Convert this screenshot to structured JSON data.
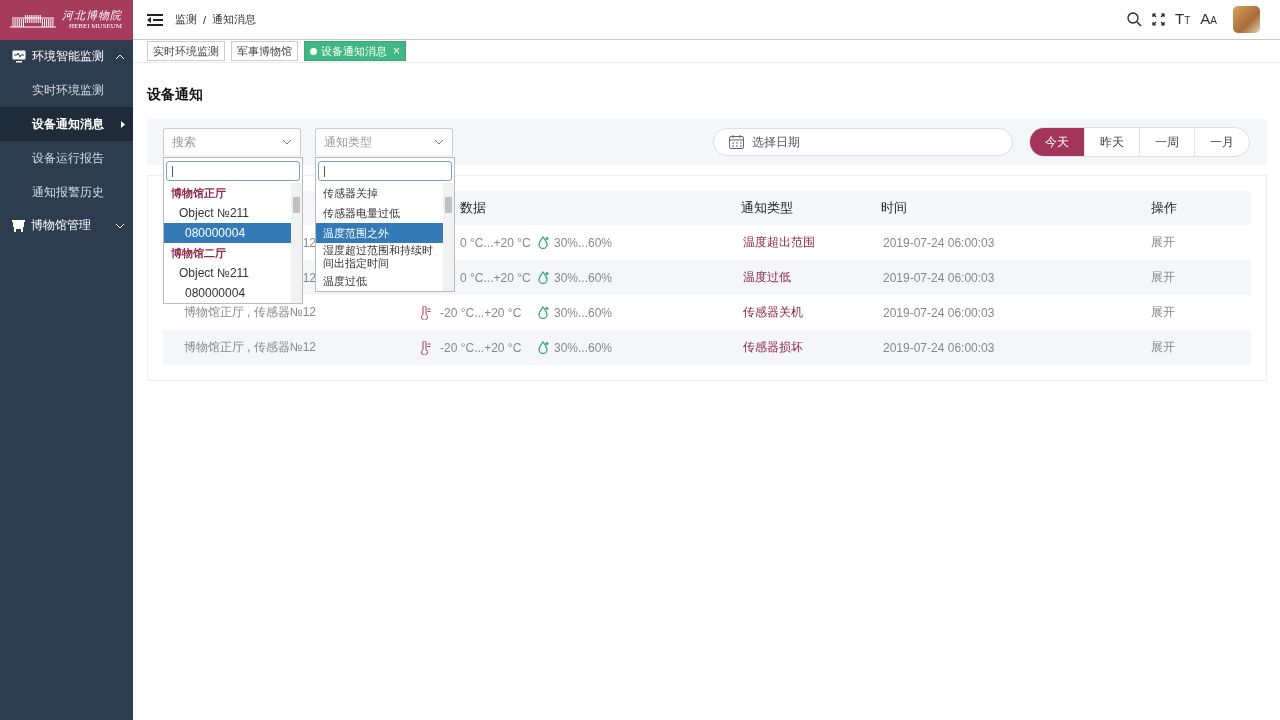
{
  "sidebar": {
    "logo": {
      "title": "河北博物院",
      "subtitle": "HEBEI MUSEUM"
    },
    "sections": [
      {
        "label": "环境智能监测",
        "expanded": true,
        "children": [
          {
            "label": "实时环境监测",
            "selected": false
          },
          {
            "label": "设备通知消息",
            "selected": true
          },
          {
            "label": "设备运行报告",
            "selected": false
          },
          {
            "label": "通知报警历史",
            "selected": false
          }
        ]
      },
      {
        "label": "博物馆管理",
        "expanded": false
      }
    ]
  },
  "header": {
    "breadcrumb": {
      "items": [
        "监测",
        "通知消息"
      ],
      "separator": "/"
    },
    "tools": [
      {
        "kind": "search"
      },
      {
        "kind": "fullscreen"
      },
      {
        "kind": "letters",
        "big": "T",
        "small": "T"
      },
      {
        "kind": "letters",
        "big": "A",
        "small": "A"
      },
      {
        "kind": "avatar"
      }
    ]
  },
  "tabs": [
    {
      "label": "实时环境监测",
      "selected": false
    },
    {
      "label": "军事博物馆",
      "selected": false
    },
    {
      "label": "设备通知消息",
      "selected": true,
      "close": "×"
    }
  ],
  "page_title": "设备通知",
  "filters": {
    "location_select": {
      "placeholder": "搜索",
      "open": true,
      "items": [
        {
          "kind": "group",
          "label": "博物馆正厅",
          "selected": false
        },
        {
          "kind": "object",
          "label": "Object №211",
          "selected": false
        },
        {
          "kind": "device",
          "label": "080000004",
          "selected": true
        },
        {
          "kind": "group",
          "label": "博物馆二厅",
          "selected": false
        },
        {
          "kind": "object",
          "label": "Object №211",
          "selected": false
        },
        {
          "kind": "device",
          "label": "080000004",
          "selected": false
        }
      ]
    },
    "type_select": {
      "placeholder": "通知类型",
      "open": true,
      "items": [
        {
          "kind": "option",
          "label": "传感器关掉",
          "selected": false
        },
        {
          "kind": "option",
          "label": "传感器电量过低",
          "selected": false
        },
        {
          "kind": "option",
          "label": "温度范围之外",
          "selected": true
        },
        {
          "kind": "option",
          "label": "湿度超过范围和持续时间出指定时间",
          "selected": false
        },
        {
          "kind": "option",
          "label": "温度过低",
          "selected": false
        }
      ]
    },
    "date": {
      "placeholder": "选择日期"
    },
    "ranges": [
      {
        "label": "今天",
        "selected": true
      },
      {
        "label": "昨天",
        "selected": false
      },
      {
        "label": "一周",
        "selected": false
      },
      {
        "label": "一月",
        "selected": false
      }
    ]
  },
  "table": {
    "columns": {
      "data": "数据",
      "type": "通知类型",
      "time": "时间",
      "action": "操作"
    },
    "rows": [
      {
        "location": "12",
        "thermometer": false,
        "temperature": "0 °C...+20 °C",
        "humidity": "30%...60%",
        "type": "温度超出范围",
        "time": "2019-07-24 06:00:03",
        "action": "展开"
      },
      {
        "location": "12",
        "thermometer": false,
        "temperature": "0 °C...+20 °C",
        "humidity": "30%...60%",
        "type": "温度过低",
        "time": "2019-07-24 06:00:03",
        "action": "展开"
      },
      {
        "location": "博物馆正厅 , 传感器№12",
        "thermometer": true,
        "temperature": "-20 °C...+20 °C",
        "humidity": "30%...60%",
        "type": "传感器关机",
        "time": "2019-07-24 06:00:03",
        "action": "展开"
      },
      {
        "location": "博物馆正厅 , 传感器№12",
        "thermometer": true,
        "temperature": "-20 °C...+20 °C",
        "humidity": "30%...60%",
        "type": "传感器损坏",
        "time": "2019-07-24 06:00:03",
        "action": "展开"
      }
    ]
  }
}
